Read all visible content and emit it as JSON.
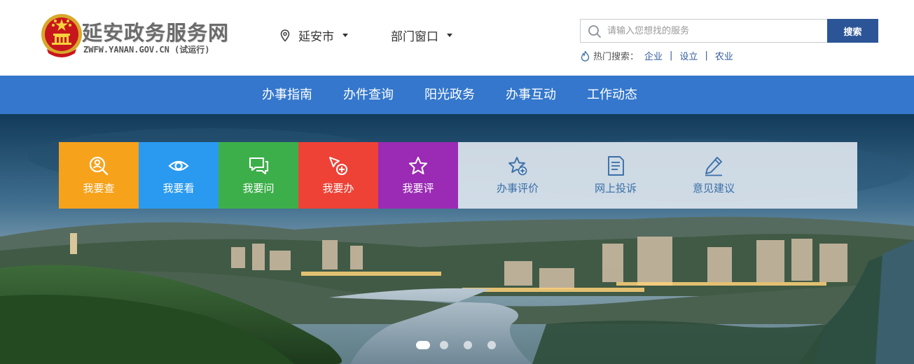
{
  "site": {
    "title": "延安政务服务网",
    "subtitle": "ZWFW.YANAN.GOV.CN (试运行)"
  },
  "header": {
    "location": {
      "label": "延安市",
      "icon": "map-pin-icon"
    },
    "department": {
      "label": "部门窗口"
    },
    "search": {
      "placeholder": "请输入您想找的服务",
      "value": "",
      "button_label": "搜索"
    },
    "hot": {
      "label": "热门搜索：",
      "keywords": [
        "企业",
        "设立",
        "农业"
      ]
    }
  },
  "nav": {
    "items": [
      "办事指南",
      "办件查询",
      "阳光政务",
      "办事互动",
      "工作动态"
    ]
  },
  "quick_tiles": [
    {
      "label": "我要查",
      "icon": "search-person-icon",
      "color": "#f7a21b"
    },
    {
      "label": "我要看",
      "icon": "eye-icon",
      "color": "#2a9af0"
    },
    {
      "label": "我要问",
      "icon": "chat-icon",
      "color": "#3daf4a"
    },
    {
      "label": "我要办",
      "icon": "cursor-plus-icon",
      "color": "#ee4236"
    },
    {
      "label": "我要评",
      "icon": "star-icon",
      "color": "#9b2bb4"
    }
  ],
  "sub_actions": [
    {
      "label": "办事评价",
      "icon": "star-plus-icon"
    },
    {
      "label": "网上投诉",
      "icon": "document-icon"
    },
    {
      "label": "意见建议",
      "icon": "pencil-icon"
    }
  ],
  "carousel": {
    "slides": 4,
    "active": 0
  },
  "colors": {
    "nav_bg": "#3477cc",
    "search_button": "#2c5597",
    "link": "#2f5a9a"
  }
}
